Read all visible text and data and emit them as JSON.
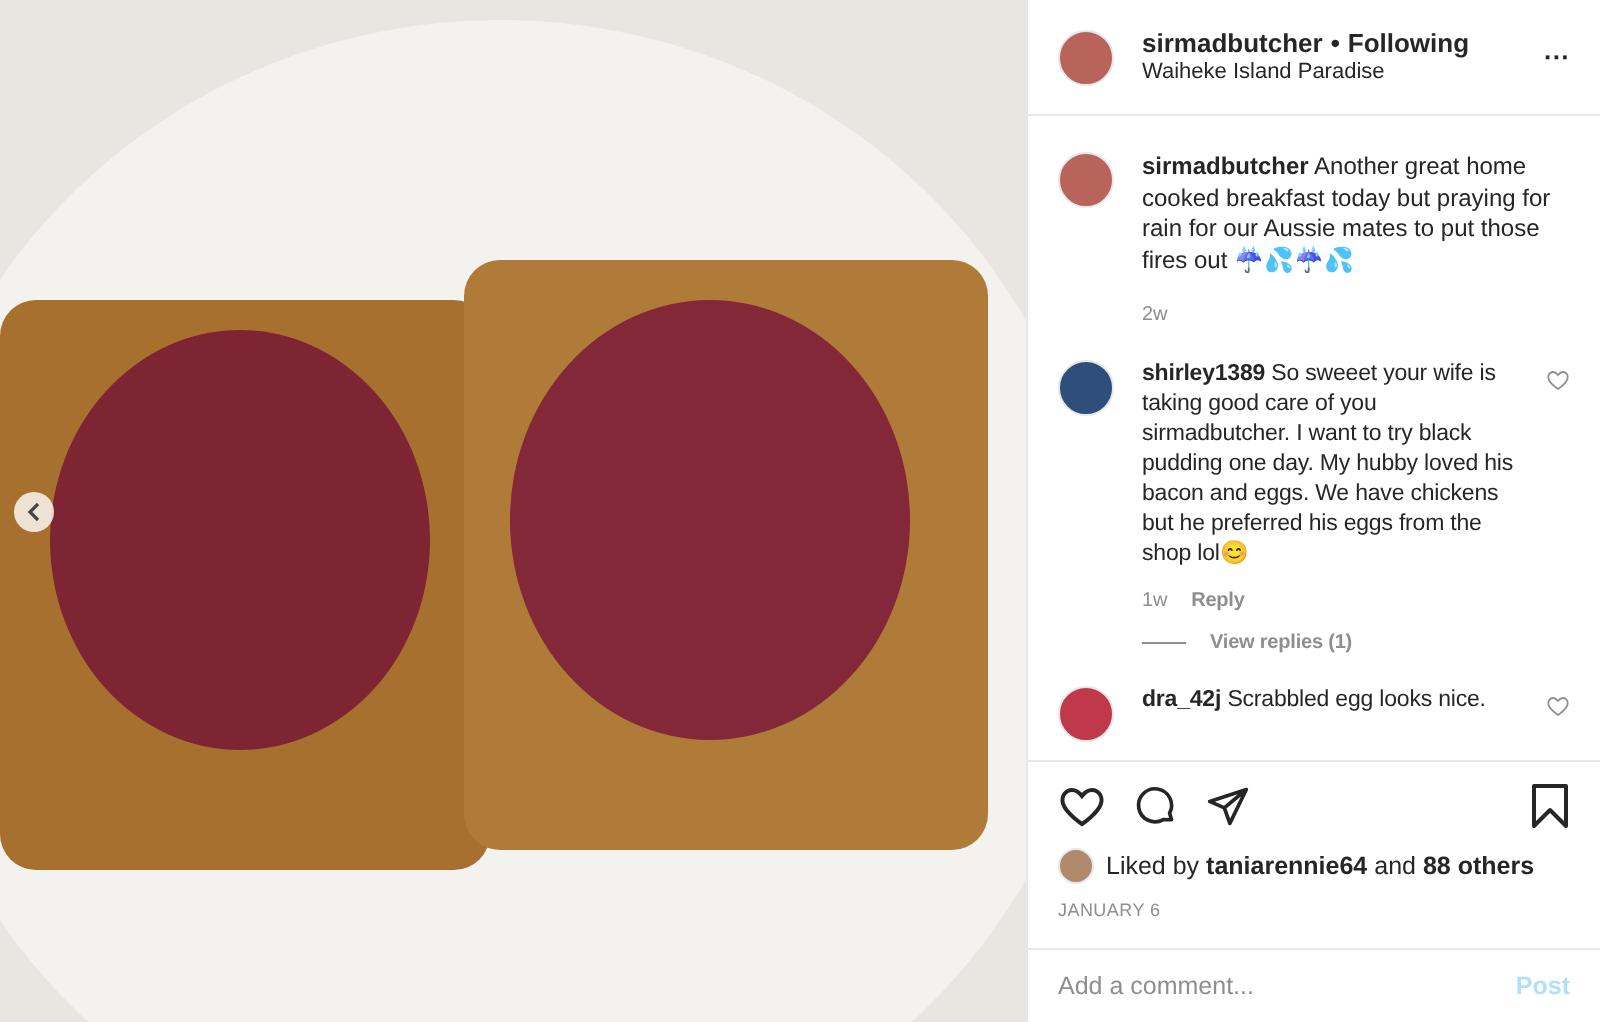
{
  "header": {
    "username": "sirmadbutcher",
    "separator": "•",
    "follow_status": "Following",
    "location": "Waiheke Island Paradise",
    "more": "···"
  },
  "caption": {
    "username": "sirmadbutcher",
    "text": "Another great home cooked breakfast today but praying for rain for our Aussie mates to put those fires out ☔💦☔💦",
    "time": "2w"
  },
  "comments": [
    {
      "username": "shirley1389",
      "text": "So sweeet your wife is taking good care of you sirmadbutcher. I want to try black pudding one day. My hubby loved his bacon and eggs. We have chickens but he preferred his eggs from the shop lol😊",
      "time": "1w",
      "reply": "Reply",
      "view_replies": "View replies (1)",
      "liked": false,
      "color": "#2f4f7a"
    },
    {
      "username": "dra_42j",
      "text": "Scrabbled egg looks nice.",
      "liked": false,
      "color": "#c0394a"
    }
  ],
  "actions": {
    "liked": false,
    "saved": false
  },
  "likes": {
    "prefix": "Liked by",
    "user": "taniarennie64",
    "middle": "and",
    "others": "88 others"
  },
  "date": "JANUARY 6",
  "comment_field": {
    "placeholder": "Add a comment..."
  },
  "post_button": {
    "label": "Post",
    "disabled": true
  }
}
